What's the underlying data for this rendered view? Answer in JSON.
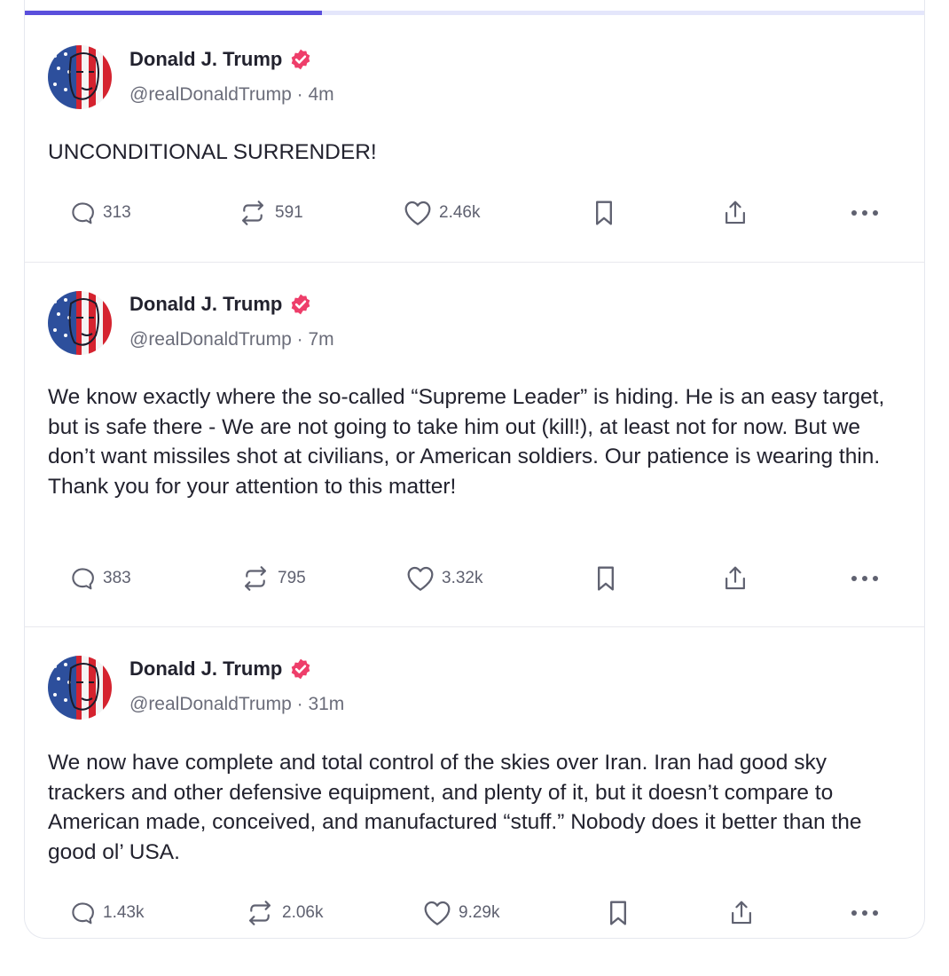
{
  "theme": {
    "accent": "#5a4fdc",
    "verified": "#ee3e6a",
    "text": "#22222e",
    "muted": "#6b6d7a"
  },
  "progress": {
    "fraction": 0.33
  },
  "posts": [
    {
      "author": {
        "name": "Donald J. Trump",
        "handle": "@realDonaldTrump",
        "verified": true,
        "avatar": "flag-portrait"
      },
      "time": "4m",
      "text": "UNCONDITIONAL SURRENDER!",
      "stats": {
        "replies": "313",
        "reposts": "591",
        "likes": "2.46k"
      }
    },
    {
      "author": {
        "name": "Donald J. Trump",
        "handle": "@realDonaldTrump",
        "verified": true,
        "avatar": "flag-portrait"
      },
      "time": "7m",
      "text": "We know exactly where the so-called “Supreme Leader” is hiding. He is an easy target, but is safe there - We are not going to take him out (kill!), at least not for now. But we don’t want missiles shot at civilians, or American soldiers. Our patience is wearing thin. Thank you for your attention to this matter!",
      "stats": {
        "replies": "383",
        "reposts": "795",
        "likes": "3.32k"
      }
    },
    {
      "author": {
        "name": "Donald J. Trump",
        "handle": "@realDonaldTrump",
        "verified": true,
        "avatar": "flag-portrait"
      },
      "time": "31m",
      "text": "We now have complete and total control of the skies over Iran. Iran had good sky trackers and other defensive equipment, and plenty of it, but it doesn’t compare to American made, conceived, and manufactured “stuff.” Nobody does it better than the good ol’ USA.",
      "stats": {
        "replies": "1.43k",
        "reposts": "2.06k",
        "likes": "9.29k"
      }
    }
  ],
  "icons": {
    "reply": "reply-icon",
    "repost": "repost-icon",
    "like": "heart-icon",
    "bookmark": "bookmark-icon",
    "share": "share-icon",
    "more": "more-icon",
    "verified": "verified-badge-icon"
  }
}
